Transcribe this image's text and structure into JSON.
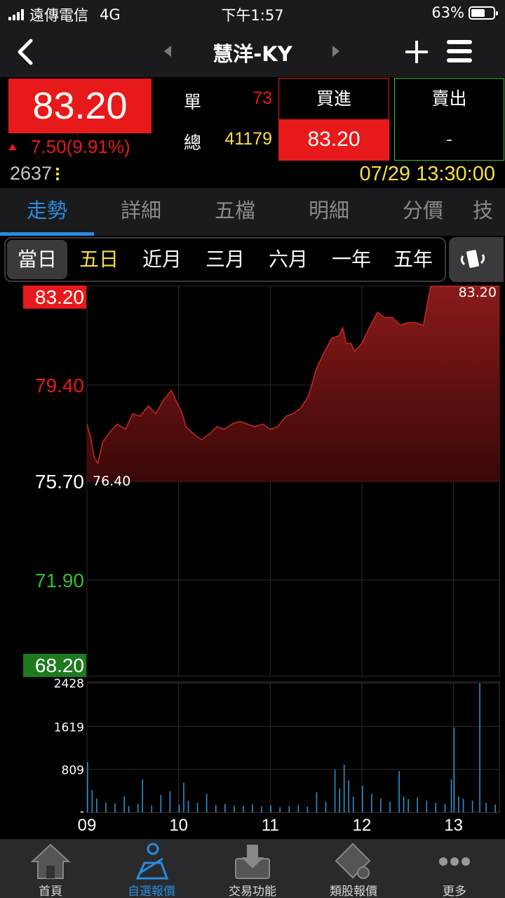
{
  "status_bar": {
    "carrier": "遠傳電信",
    "network": "4G",
    "time": "下午1:57",
    "battery": "63%",
    "battery_level": 0.63
  },
  "nav": {
    "title": "慧洋-KY",
    "icons": [
      "back-icon",
      "prev-stock-icon",
      "next-stock-icon",
      "add-icon",
      "menu-icon"
    ]
  },
  "quote": {
    "price": "83.20",
    "change": "7.50(9.91%)",
    "single_label": "單",
    "single_value": "73",
    "total_label": "總",
    "total_value": "41179",
    "buy_label": "買進",
    "buy_price": "83.20",
    "sell_label": "賣出",
    "sell_price": "-",
    "volume": "2637",
    "datetime": "07/29 13:30:00"
  },
  "tabs": [
    "走勢",
    "詳細",
    "五檔",
    "明細",
    "分價",
    "技"
  ],
  "periods": [
    "當日",
    "五日",
    "近月",
    "三月",
    "六月",
    "一年",
    "五年"
  ],
  "bottom_nav": [
    {
      "label": "首頁",
      "icon": "home-icon"
    },
    {
      "label": "自選報價",
      "icon": "watchlist-icon"
    },
    {
      "label": "交易功能",
      "icon": "trade-icon"
    },
    {
      "label": "類股報價",
      "icon": "sector-icon"
    },
    {
      "label": "更多",
      "icon": "more-icon"
    }
  ],
  "colors": {
    "up": "#e8191a",
    "down": "#2fbf2f",
    "accent": "#2b8cdf",
    "highlight": "#f5e042"
  },
  "chart_data": {
    "type": "area",
    "price_ticks": [
      "83.20",
      "79.40",
      "75.70",
      "71.90",
      "68.20"
    ],
    "ylim": [
      68.2,
      83.2
    ],
    "x_ticks": [
      "09",
      "10",
      "11",
      "12",
      "13"
    ],
    "x_hours": [
      9,
      10,
      11,
      12,
      13
    ],
    "xlim": [
      9,
      13.5
    ],
    "reference_price": 75.7,
    "annotations": {
      "high": "83.20",
      "low": "76.40"
    },
    "series": [
      {
        "x": [
          9.0,
          9.04,
          9.08,
          9.12,
          9.17,
          9.25,
          9.33,
          9.42,
          9.5,
          9.58,
          9.67,
          9.75,
          9.83,
          9.92,
          10.0,
          10.04,
          10.08,
          10.17,
          10.25,
          10.33,
          10.42,
          10.5,
          10.58,
          10.67,
          10.75,
          10.83,
          10.92,
          11.0,
          11.08,
          11.17,
          11.25,
          11.33,
          11.42,
          11.5,
          11.58,
          11.67,
          11.75,
          11.79,
          11.83,
          11.88,
          11.92,
          12.0,
          12.04,
          12.08,
          12.17,
          12.25,
          12.33,
          12.42,
          12.5,
          12.58,
          12.67,
          12.75,
          12.83,
          12.92,
          13.0,
          13.08,
          13.17,
          13.25,
          13.33,
          13.42,
          13.5
        ],
        "y": [
          77.9,
          77.4,
          76.6,
          76.4,
          77.2,
          77.6,
          77.9,
          77.7,
          78.3,
          78.2,
          78.6,
          78.3,
          78.8,
          79.2,
          78.6,
          78.3,
          77.8,
          77.5,
          77.3,
          77.5,
          77.8,
          77.7,
          77.9,
          78.0,
          77.9,
          77.8,
          77.9,
          77.7,
          77.8,
          78.2,
          78.3,
          78.5,
          79.0,
          80.0,
          80.6,
          81.2,
          81.3,
          81.6,
          81.0,
          81.0,
          80.7,
          81.0,
          81.3,
          81.6,
          82.2,
          82.0,
          82.0,
          81.7,
          81.8,
          81.8,
          81.7,
          83.2,
          83.2,
          83.2,
          83.2,
          83.2,
          83.2,
          83.2,
          83.2,
          83.2,
          83.2
        ]
      }
    ],
    "volume": {
      "ticks": [
        "2428",
        "1619",
        "809",
        "-"
      ],
      "ylim": [
        0,
        2428
      ],
      "x": [
        9.0,
        9.05,
        9.1,
        9.2,
        9.3,
        9.4,
        9.45,
        9.55,
        9.6,
        9.7,
        9.8,
        9.9,
        10.0,
        10.05,
        10.1,
        10.2,
        10.3,
        10.4,
        10.5,
        10.6,
        10.7,
        10.8,
        10.9,
        11.0,
        11.1,
        11.2,
        11.3,
        11.4,
        11.5,
        11.6,
        11.7,
        11.75,
        11.8,
        11.85,
        11.9,
        12.0,
        12.1,
        12.2,
        12.3,
        12.4,
        12.45,
        12.5,
        12.6,
        12.7,
        12.8,
        12.9,
        12.97,
        13.0,
        13.05,
        13.1,
        13.2,
        13.28,
        13.35,
        13.45
      ],
      "values": [
        950,
        420,
        260,
        180,
        170,
        300,
        120,
        160,
        620,
        130,
        330,
        400,
        150,
        560,
        220,
        180,
        350,
        140,
        160,
        130,
        120,
        150,
        110,
        130,
        100,
        120,
        140,
        110,
        380,
        200,
        800,
        450,
        900,
        600,
        300,
        500,
        350,
        260,
        200,
        780,
        300,
        250,
        280,
        220,
        180,
        160,
        620,
        1600,
        300,
        260,
        220,
        2428,
        180,
        150
      ]
    }
  }
}
